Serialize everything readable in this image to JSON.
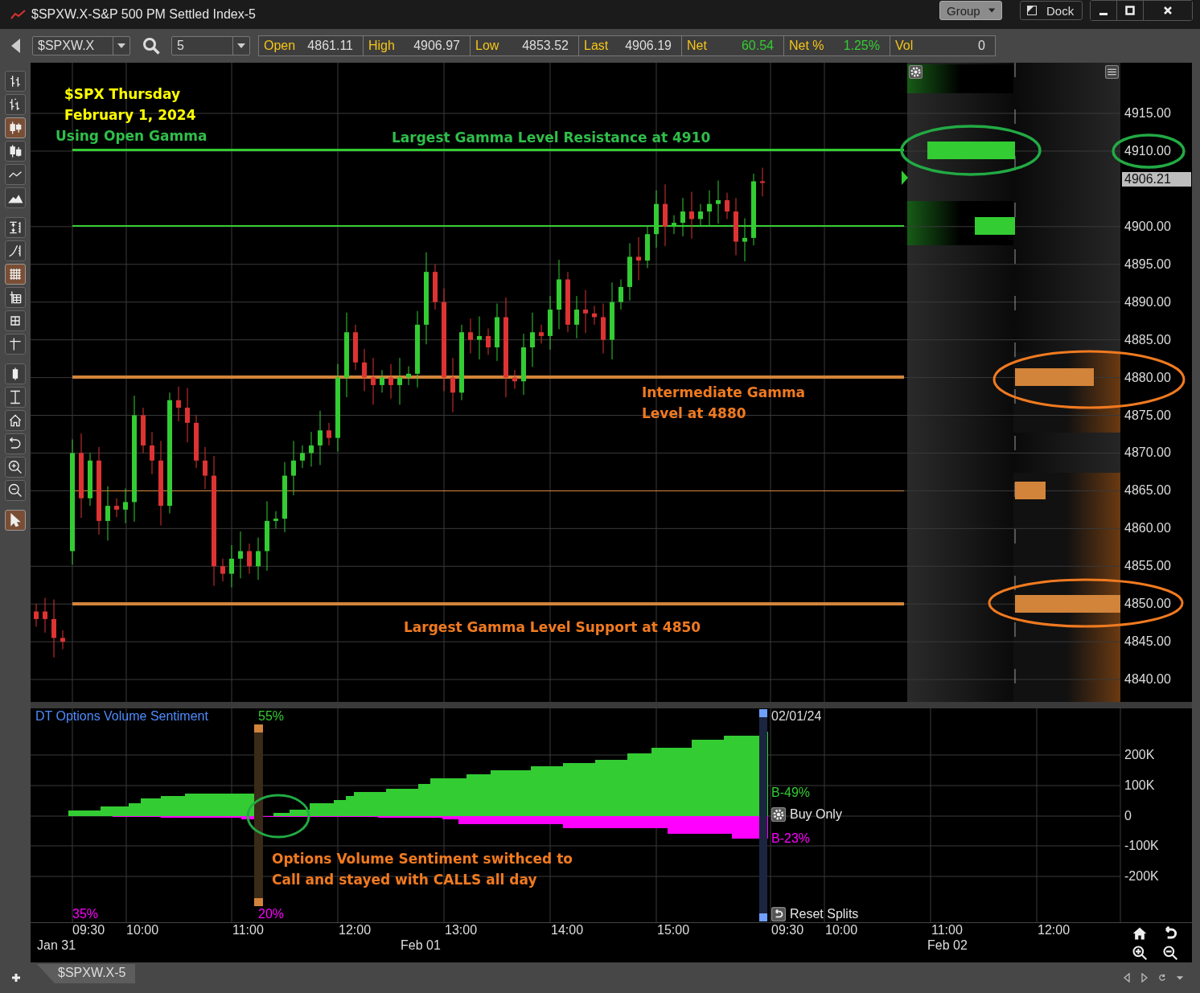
{
  "window": {
    "title": "$SPXW.X-S&P 500 PM Settled Index-5",
    "group_button": "Group",
    "dock_button": "Dock"
  },
  "toolbar": {
    "symbol": "$SPXW.X",
    "interval": "5",
    "quotes": [
      {
        "label": "Open",
        "value": "4861.11",
        "kind": "price"
      },
      {
        "label": "High",
        "value": "4906.97",
        "kind": "price"
      },
      {
        "label": "Low",
        "value": "4853.52",
        "kind": "price"
      },
      {
        "label": "Last",
        "value": "4906.19",
        "kind": "price"
      },
      {
        "label": "Net",
        "value": "60.54",
        "kind": "change"
      },
      {
        "label": "Net %",
        "value": "1.25%",
        "kind": "change"
      },
      {
        "label": "Vol",
        "value": "0",
        "kind": "price"
      }
    ]
  },
  "tools": [
    [
      {
        "selected": false
      },
      {
        "selected": false
      },
      {
        "selected": true
      },
      {
        "selected": false
      },
      {
        "selected": false
      },
      {
        "selected": false
      }
    ],
    [
      {
        "selected": false
      },
      {
        "selected": false
      },
      {
        "selected": true
      },
      {
        "selected": false
      },
      {
        "selected": false
      },
      {
        "selected": false
      }
    ],
    [
      {
        "selected": false
      },
      {
        "selected": false
      },
      {
        "selected": false
      },
      {
        "selected": false
      },
      {
        "selected": false
      },
      {
        "selected": false
      }
    ],
    [
      {
        "selected": true
      }
    ]
  ],
  "price_chart": {
    "annotations": [
      {
        "text": "$SPX Thursday",
        "color": "#ffff00"
      },
      {
        "text": "February 1, 2024",
        "color": "#ffff00"
      },
      {
        "text": "Using Open Gamma",
        "color": "#2fbf4a"
      },
      {
        "text": "Largest Gamma Level Resistance at 4910",
        "color": "#2fbf4a"
      },
      {
        "text": "Intermediate Gamma\nLevel at 4880",
        "color": "#f07a20"
      },
      {
        "text": "Largest Gamma Level Support at 4850",
        "color": "#f07a20"
      }
    ],
    "price_axis": [
      "4915.00",
      "4910.00",
      "4900.00",
      "4895.00",
      "4890.00",
      "4885.00",
      "4880.00",
      "4875.00",
      "4870.00",
      "4865.00",
      "4860.00",
      "4855.00",
      "4850.00",
      "4845.00",
      "4840.00"
    ],
    "last_price": "4906.21"
  },
  "sentiment_panel": {
    "title": "DT Options Volume Sentiment",
    "readouts": [
      {
        "text": "55%",
        "color": "#33cc33"
      },
      {
        "text": "35%",
        "color": "#ff00ff"
      },
      {
        "text": "20%",
        "color": "#ff00ff"
      },
      {
        "text": "02/01/24",
        "color": "#dddddd"
      },
      {
        "text": "B-49%",
        "color": "#33cc33"
      },
      {
        "text": "B-23%",
        "color": "#ff00ff"
      }
    ],
    "buttons": [
      "Buy Only",
      "Reset Splits"
    ],
    "note": "Options Volume Sentiment swithced to\nCall and stayed with CALLS all day",
    "axis": [
      "200K",
      "100K",
      "0",
      "-100K",
      "-200K"
    ]
  },
  "time_axis": {
    "times": [
      "09:30",
      "10:00",
      "11:00",
      "12:00",
      "13:00",
      "14:00",
      "15:00",
      "09:30",
      "10:00",
      "11:00",
      "12:00"
    ],
    "dates": [
      "Jan 31",
      "Feb 01",
      "Feb 02"
    ]
  },
  "tabs": [
    {
      "label": "$SPXW.X-5",
      "selected": true
    }
  ]
}
